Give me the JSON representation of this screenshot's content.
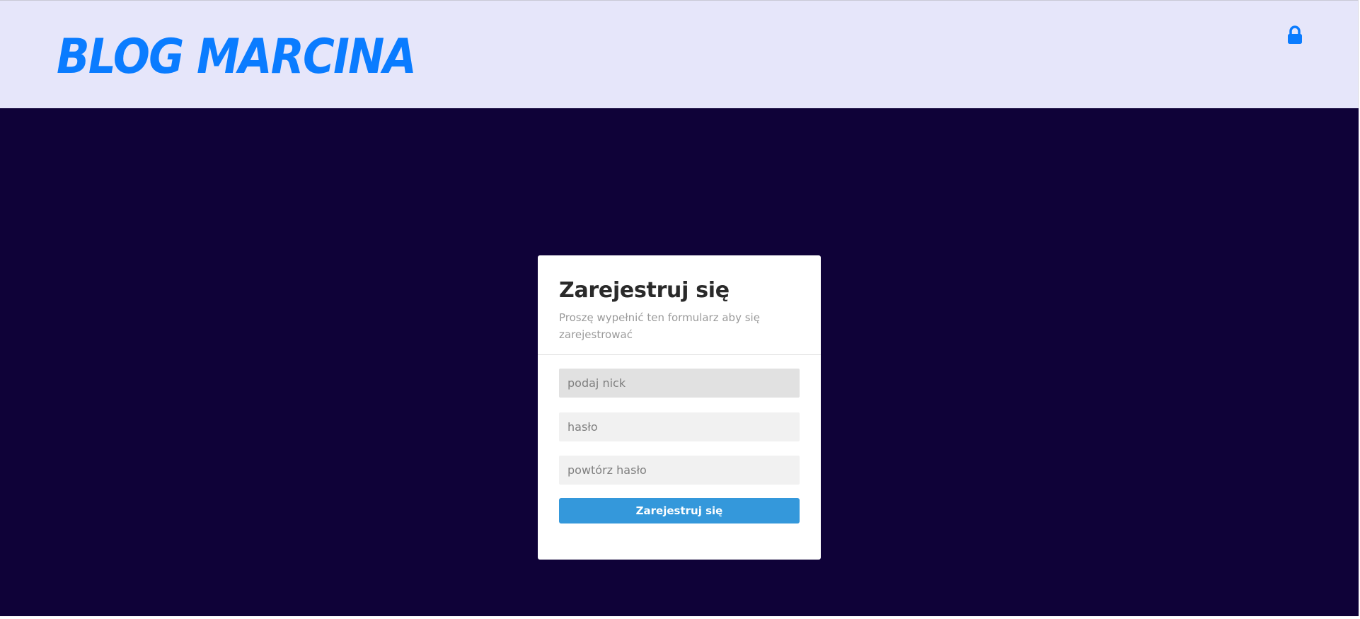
{
  "header": {
    "logo_text": "BLOG MARCINA",
    "lock_icon": "lock-icon",
    "background_color": "#e6e6fa",
    "accent_color": "#0a7cff"
  },
  "main": {
    "background_color": "#0f0238"
  },
  "register_form": {
    "title": "Zarejestruj się",
    "subtitle": "Proszę wypełnić ten formularz aby się zarejestrować",
    "nick_field": {
      "placeholder": "podaj nick",
      "value": ""
    },
    "password_field": {
      "placeholder": "hasło",
      "value": ""
    },
    "repeat_password_field": {
      "placeholder": "powtórz hasło",
      "value": ""
    },
    "submit_label": "Zarejestruj się",
    "button_color": "#3498db"
  }
}
